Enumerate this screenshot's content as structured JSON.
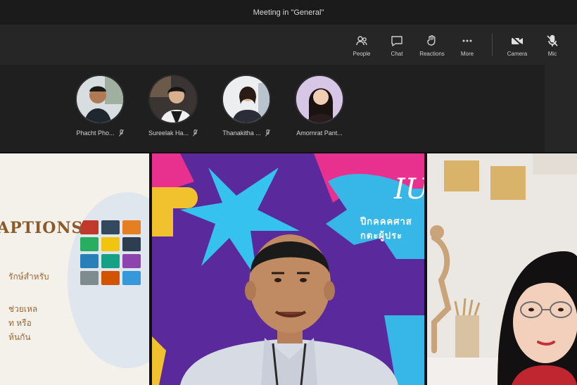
{
  "window": {
    "title": "Meeting in \"General\""
  },
  "toolbar": {
    "buttons": [
      {
        "label": "People",
        "icon": "people-icon"
      },
      {
        "label": "Chat",
        "icon": "chat-icon"
      },
      {
        "label": "Reactions",
        "icon": "reactions-icon"
      },
      {
        "label": "More",
        "icon": "more-icon"
      },
      {
        "label": "Camera",
        "icon": "camera-icon"
      },
      {
        "label": "Mic",
        "icon": "mic-icon"
      }
    ]
  },
  "attendees": [
    {
      "name": "Phacht Pho...",
      "muted": true
    },
    {
      "name": "Sureelak Ha...",
      "muted": true
    },
    {
      "name": "Thanakitha ...",
      "muted": true
    },
    {
      "name": "Amornrat Pant...",
      "muted": false
    }
  ],
  "tiles": {
    "slide": {
      "title": "APTIONS",
      "lines": [
        "รักษ์สำหรับ",
        "ช่วยเหล",
        "ท หรือ",
        "ห้นกัน"
      ]
    },
    "presenter": {
      "overlay_big": "IU",
      "overlay_line1": "ปีกคคคศาส",
      "overlay_line2": "กตะผู้ประ"
    }
  },
  "colors": {
    "purple_bg": "#5a2a9c",
    "slide_accent": "#8a5a2b",
    "toolbar_bg": "#262626"
  }
}
